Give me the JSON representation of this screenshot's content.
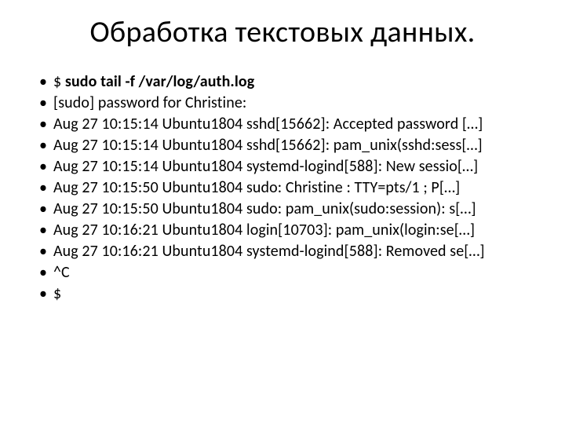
{
  "title": "Обработка текстовых данных.",
  "items": [
    {
      "prefix": "$ ",
      "bold": "sudo tail -f /var/log/auth.log"
    },
    {
      "text": "[sudo] password for Christine:"
    },
    {
      "text": "Aug 27 10:15:14 Ubuntu1804 sshd[15662]: Accepted password […]"
    },
    {
      "text": "Aug 27 10:15:14 Ubuntu1804 sshd[15662]: pam_unix(sshd:sess[…]"
    },
    {
      "text": "Aug 27 10:15:14 Ubuntu1804 systemd-logind[588]: New sessio[…]"
    },
    {
      "text": "Aug 27 10:15:50 Ubuntu1804 sudo: Christine : TTY=pts/1 ; P[…]"
    },
    {
      "text": "Aug 27 10:15:50 Ubuntu1804 sudo: pam_unix(sudo:session): s[…]"
    },
    {
      "text": "Aug 27 10:16:21 Ubuntu1804 login[10703]: pam_unix(login:se[…]"
    },
    {
      "text": "Aug 27 10:16:21 Ubuntu1804 systemd-logind[588]: Removed se[…]"
    },
    {
      "text": "^C"
    },
    {
      "text": "$"
    }
  ]
}
